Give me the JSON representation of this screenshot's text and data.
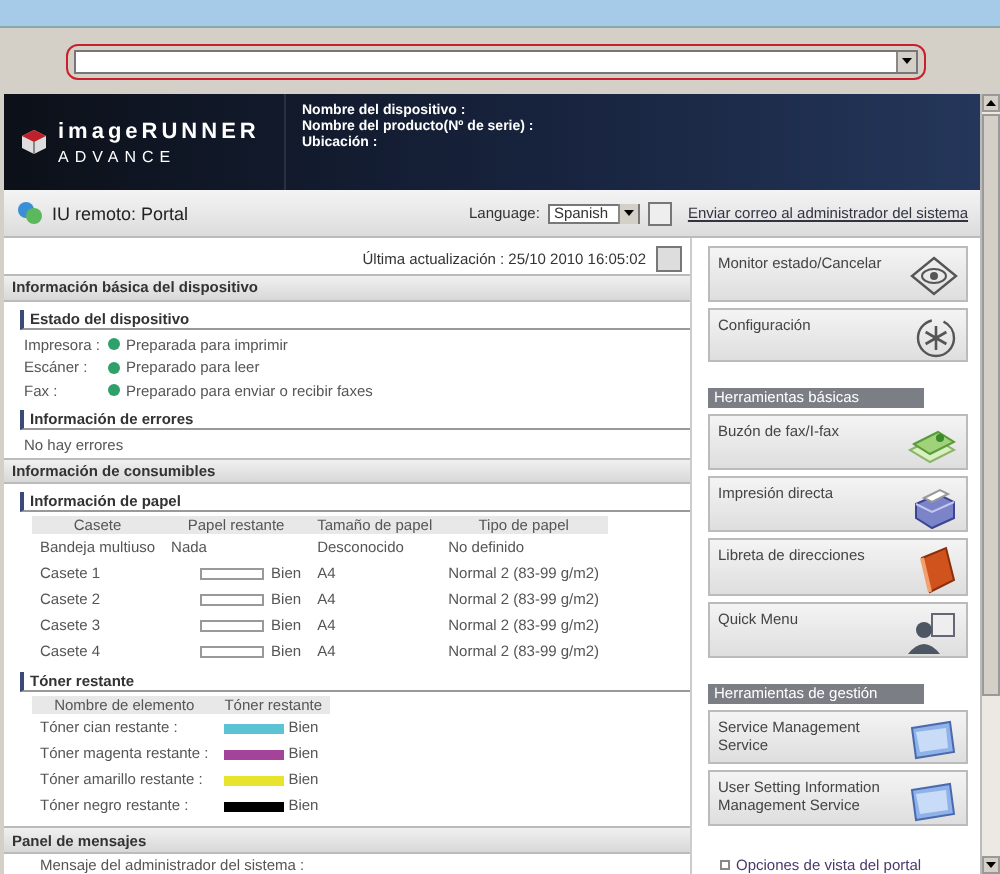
{
  "header": {
    "logo_top": "imageRUNNER",
    "logo_bottom": "ADVANCE",
    "fields": [
      "Nombre del dispositivo :",
      "Nombre del producto(Nº de serie) :",
      "Ubicación :"
    ]
  },
  "portal_bar": {
    "title": "IU remoto: Portal",
    "language_label": "Language:",
    "language_value": "Spanish",
    "admin_link": "Enviar correo al administrador del sistema"
  },
  "last_update": "Última actualización : 25/10 2010 16:05:02",
  "basic_info": {
    "title": "Información básica del dispositivo",
    "status_title": "Estado del dispositivo",
    "status": [
      {
        "label": "Impresora :",
        "value": "Preparada para imprimir"
      },
      {
        "label": "Escáner :",
        "value": "Preparado para leer"
      },
      {
        "label": "Fax :",
        "value": "Preparado para enviar o recibir faxes"
      }
    ],
    "errors_title": "Información de errores",
    "errors": "No hay errores"
  },
  "consumables": {
    "title": "Información de consumibles",
    "paper_title": "Información de papel",
    "paper_columns": [
      "Casete",
      "Papel restante",
      "Tamaño de papel",
      "Tipo de papel"
    ],
    "paper_rows": [
      {
        "kind": "text",
        "name": "Bandeja multiuso",
        "remaining": "Nada",
        "size": "Desconocido",
        "type": "No definido"
      },
      {
        "kind": "bar",
        "name": "Casete 1",
        "remaining": "Bien",
        "size": "A4",
        "type": "Normal 2 (83-99 g/m2)"
      },
      {
        "kind": "bar",
        "name": "Casete 2",
        "remaining": "Bien",
        "size": "A4",
        "type": "Normal 2 (83-99 g/m2)"
      },
      {
        "kind": "bar",
        "name": "Casete 3",
        "remaining": "Bien",
        "size": "A4",
        "type": "Normal 2 (83-99 g/m2)"
      },
      {
        "kind": "bar",
        "name": "Casete 4",
        "remaining": "Bien",
        "size": "A4",
        "type": "Normal 2 (83-99 g/m2)"
      }
    ],
    "toner_title": "Tóner restante",
    "toner_columns": [
      "Nombre de elemento",
      "Tóner restante"
    ],
    "toner_rows": [
      {
        "name": "Tóner cian restante :",
        "color": "#5bc3d3",
        "status": "Bien"
      },
      {
        "name": "Tóner magenta restante :",
        "color": "#a3449a",
        "status": "Bien"
      },
      {
        "name": "Tóner amarillo restante :",
        "color": "#e8e32c",
        "status": "Bien"
      },
      {
        "name": "Tóner negro restante :",
        "color": "#000000",
        "status": "Bien"
      }
    ]
  },
  "messages": {
    "title": "Panel de mensajes",
    "line": "Mensaje del administrador del sistema :"
  },
  "side": [
    {
      "kind": "button",
      "label": "Monitor estado/Cancelar"
    },
    {
      "kind": "button",
      "label": "Configuración"
    },
    {
      "kind": "heading",
      "label": "Herramientas básicas"
    },
    {
      "kind": "button",
      "label": "Buzón de fax/I-fax"
    },
    {
      "kind": "button",
      "label": "Impresión directa"
    },
    {
      "kind": "button",
      "label": "Libreta de direcciones"
    },
    {
      "kind": "button",
      "label": "Quick Menu"
    },
    {
      "kind": "heading",
      "label": "Herramientas de gestión"
    },
    {
      "kind": "button",
      "label": "Service Management Service"
    },
    {
      "kind": "button",
      "label": "User Setting Information Management Service"
    },
    {
      "kind": "link",
      "label": "Opciones de vista del portal"
    }
  ]
}
